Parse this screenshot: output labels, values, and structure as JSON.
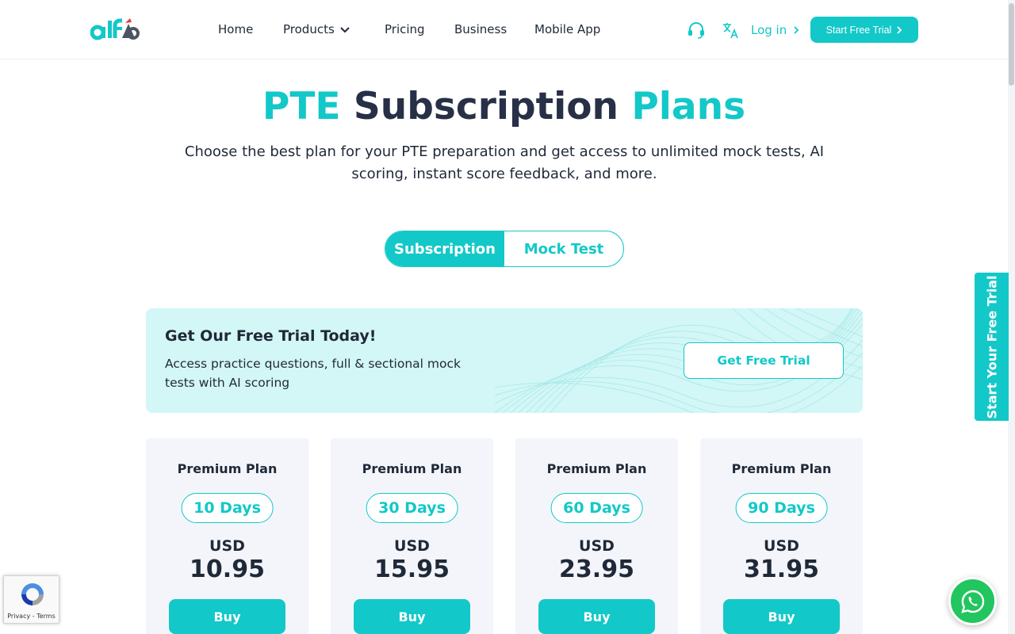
{
  "header": {
    "nav": [
      {
        "label": "Home"
      },
      {
        "label": "Products"
      },
      {
        "label": "Pricing"
      },
      {
        "label": "Business"
      },
      {
        "label": "Mobile App"
      }
    ],
    "support_icon": "headset-icon",
    "language_icon": "translate-icon",
    "login_label": "Log in",
    "cta_label": "Start Free Trial"
  },
  "hero": {
    "title_part1": "PTE",
    "title_part2": "Subscription",
    "title_part3": "Plans",
    "subtitle": "Choose the best plan for your PTE preparation and get access to unlimited mock tests, AI scoring, instant score feedback, and more."
  },
  "toggle": {
    "options": [
      "Subscription",
      "Mock Test"
    ],
    "selected": "Subscription"
  },
  "banner": {
    "title": "Get Our Free Trial Today!",
    "text": "Access practice questions, full & sectional mock tests with AI scoring",
    "button_label": "Get Free Trial"
  },
  "plans": [
    {
      "name": "Premium Plan",
      "duration": "10 Days",
      "currency": "USD",
      "price": "10.95",
      "button": "Buy"
    },
    {
      "name": "Premium Plan",
      "duration": "30 Days",
      "currency": "USD",
      "price": "15.95",
      "button": "Buy"
    },
    {
      "name": "Premium Plan",
      "duration": "60 Days",
      "currency": "USD",
      "price": "23.95",
      "button": "Buy"
    },
    {
      "name": "Premium Plan",
      "duration": "90 Days",
      "currency": "USD",
      "price": "31.95",
      "button": "Buy"
    }
  ],
  "side_tab": {
    "label": "Start Your Free Trial"
  },
  "recaptcha": {
    "links": "Privacy - Terms"
  },
  "colors": {
    "accent": "#13c8c8",
    "title_dark": "#283047",
    "banner_bg": "#d3f6f6",
    "card_bg": "#f3f5fb",
    "whatsapp": "#22c55e"
  }
}
